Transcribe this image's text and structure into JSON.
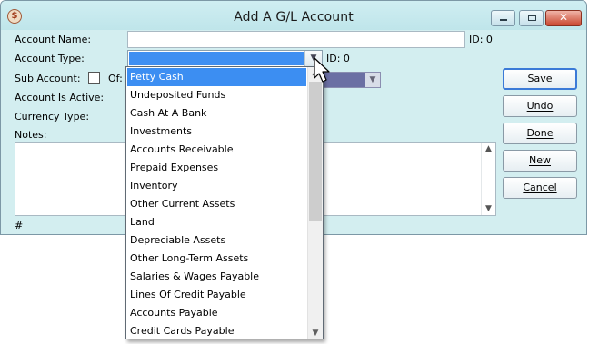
{
  "window": {
    "title": "Add A G/L Account",
    "app_icon_glyph": "$",
    "close_glyph": "✕"
  },
  "form": {
    "account_name_label": "Account Name:",
    "account_name_value": "",
    "id_label_top": "ID: 0",
    "account_type_label": "Account Type:",
    "account_type_value": "",
    "id_label_type": "ID: 0",
    "sub_account_label": "Sub Account:",
    "of_label": "Of:",
    "account_active_label": "Account Is Active:",
    "currency_type_label": "Currency Type:",
    "notes_label": "Notes:",
    "notes_value": "",
    "record_marker": "#"
  },
  "buttons": {
    "save": "Save",
    "undo": "Undo",
    "done": "Done",
    "new": "New",
    "cancel": "Cancel"
  },
  "dropdown": {
    "selected_index": 0,
    "items": [
      "Petty Cash",
      "Undeposited Funds",
      "Cash At A Bank",
      "Investments",
      "Accounts Receivable",
      "Prepaid Expenses",
      "Inventory",
      "Other Current Assets",
      "Land",
      "Depreciable Assets",
      "Other Long-Term Assets",
      "Salaries & Wages Payable",
      "Lines Of Credit Payable",
      "Accounts Payable",
      "Credit Cards Payable"
    ]
  },
  "icons": {
    "combo_arrow": "chevron-down-icon",
    "scroll_up": "chevron-up-icon",
    "scroll_down": "chevron-down-icon",
    "app": "dollar-icon",
    "cursor": "mouse-pointer-icon"
  },
  "colors": {
    "window_bg": "#d3eef0",
    "selection": "#3c8ef2",
    "save_border": "#3b7ad7",
    "close_button": "#c9462e"
  }
}
